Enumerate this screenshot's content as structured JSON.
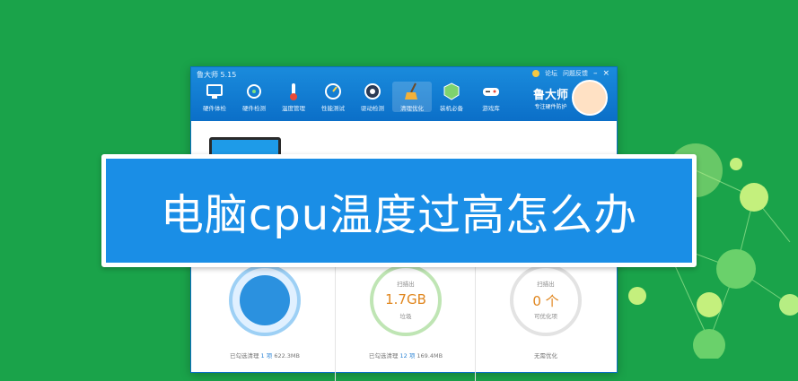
{
  "window": {
    "title": "鲁大师 5.15",
    "menu": {
      "forum": "论坛",
      "feedback": "问题反馈"
    },
    "controls": {
      "minimize": "–",
      "close": "×"
    }
  },
  "toolbar": {
    "items": [
      {
        "label": "硬件体检",
        "icon": "hardware-check-icon"
      },
      {
        "label": "硬件检测",
        "icon": "hardware-detect-icon"
      },
      {
        "label": "温度管理",
        "icon": "thermometer-icon"
      },
      {
        "label": "性能测试",
        "icon": "speedometer-icon"
      },
      {
        "label": "驱动检测",
        "icon": "driver-icon"
      },
      {
        "label": "清理优化",
        "icon": "broom-icon",
        "active": true
      },
      {
        "label": "装机必备",
        "icon": "cube-icon"
      },
      {
        "label": "游戏库",
        "icon": "gamepad-icon"
      }
    ]
  },
  "brand": {
    "name": "鲁大师",
    "tagline": "专注硬件防护"
  },
  "banner": {
    "text": "电脑cpu温度过高怎么办"
  },
  "panels": [
    {
      "footer_prefix": "已勾选清理",
      "footer_count": "1 项",
      "footer_size": "622.3MB"
    },
    {
      "label": "扫描出",
      "value": "1.7GB",
      "sub": "垃圾",
      "footer_prefix": "已勾选清理",
      "footer_count": "12 项",
      "footer_size": "169.4MB"
    },
    {
      "label": "扫描出",
      "value": "0 个",
      "sub": "可优化项",
      "footer": "无需优化"
    }
  ],
  "colors": {
    "background": "#1aa34a",
    "accent": "#1a8ee6",
    "value": "#e0861e"
  }
}
